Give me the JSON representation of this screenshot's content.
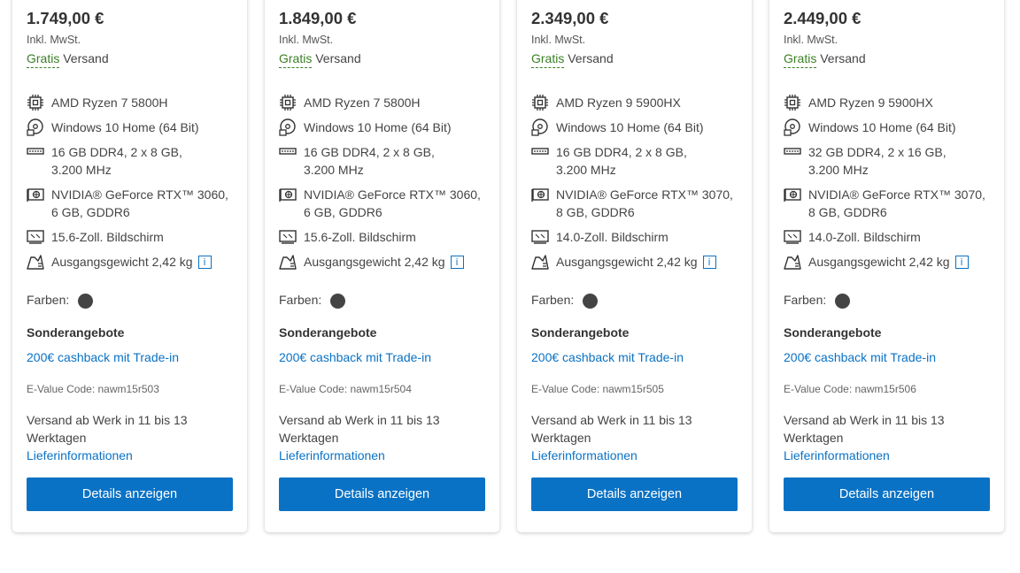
{
  "labels": {
    "vat": "Inkl. MwSt.",
    "gratis": "Gratis",
    "versand": "Versand",
    "colors": "Farben:",
    "special_offers": "Sonderangebote",
    "cashback": "200€ cashback mit Trade-in",
    "delivery_link": "Lieferinformationen",
    "button": "Details anzeigen",
    "info": "i"
  },
  "colors": {
    "accent": "#0a72c5",
    "gratis": "#3a7f24",
    "swatch": "#444444"
  },
  "products": [
    {
      "price": "1.749,00 €",
      "cpu": "AMD Ryzen 7 5800H",
      "os": "Windows 10 Home (64 Bit)",
      "ram_line1": "16 GB DDR4, 2 x 8 GB,",
      "ram_line2": "3.200 MHz",
      "gpu_line1": "NVIDIA® GeForce RTX™ 3060,",
      "gpu_line2": "6 GB, GDDR6",
      "screen": "15.6-Zoll. Bildschirm",
      "weight": "Ausgangsgewicht 2,42 kg",
      "evalue": "E-Value Code: nawm15r503",
      "delivery_line1": "Versand ab Werk in 11 bis 13",
      "delivery_line2": "Werktagen"
    },
    {
      "price": "1.849,00 €",
      "cpu": "AMD Ryzen 7 5800H",
      "os": "Windows 10 Home (64 Bit)",
      "ram_line1": "16 GB DDR4, 2 x 8 GB,",
      "ram_line2": "3.200 MHz",
      "gpu_line1": "NVIDIA® GeForce RTX™ 3060,",
      "gpu_line2": "6 GB, GDDR6",
      "screen": "15.6-Zoll. Bildschirm",
      "weight": "Ausgangsgewicht 2,42 kg",
      "evalue": "E-Value Code: nawm15r504",
      "delivery_line1": "Versand ab Werk in 11 bis 13",
      "delivery_line2": "Werktagen"
    },
    {
      "price": "2.349,00 €",
      "cpu": "AMD Ryzen 9 5900HX",
      "os": "Windows 10 Home (64 Bit)",
      "ram_line1": "16 GB DDR4, 2 x 8 GB,",
      "ram_line2": "3.200 MHz",
      "gpu_line1": "NVIDIA® GeForce RTX™ 3070,",
      "gpu_line2": "8 GB, GDDR6",
      "screen": "14.0-Zoll. Bildschirm",
      "weight": "Ausgangsgewicht 2,42 kg",
      "evalue": "E-Value Code: nawm15r505",
      "delivery_line1": "Versand ab Werk in 11 bis 13",
      "delivery_line2": "Werktagen"
    },
    {
      "price": "2.449,00 €",
      "cpu": "AMD Ryzen 9 5900HX",
      "os": "Windows 10 Home (64 Bit)",
      "ram_line1": "32 GB DDR4, 2 x 16 GB,",
      "ram_line2": "3.200 MHz",
      "gpu_line1": "NVIDIA® GeForce RTX™ 3070,",
      "gpu_line2": "8 GB, GDDR6",
      "screen": "14.0-Zoll. Bildschirm",
      "weight": "Ausgangsgewicht 2,42 kg",
      "evalue": "E-Value Code: nawm15r506",
      "delivery_line1": "Versand ab Werk in 11 bis 13",
      "delivery_line2": "Werktagen"
    }
  ]
}
